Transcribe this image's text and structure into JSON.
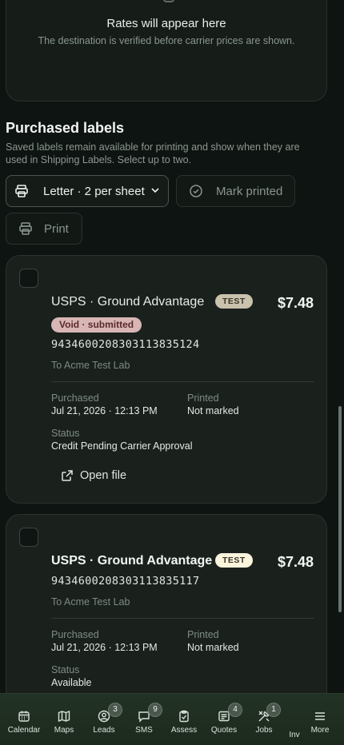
{
  "rates": {
    "title": "Rates will appear here",
    "subtitle": "The destination is verified before carrier prices are shown."
  },
  "purchased": {
    "title": "Purchased labels",
    "description": "Saved labels remain available for printing and show when they are used in Shipping Labels. Select up to two.",
    "format_select": "Letter · 2 per sheet",
    "mark_printed": "Mark printed",
    "print": "Print"
  },
  "labels": [
    {
      "carrier": "USPS · Ground Advantage",
      "tag": "TEST",
      "price": "$7.48",
      "badge": "Void · submitted",
      "tracking": "9434600208303113835124",
      "to": "To Acme Test Lab",
      "purchased_label": "Purchased",
      "purchased_value": "Jul 21, 2026 · 12:13 PM",
      "printed_label": "Printed",
      "printed_value": "Not marked",
      "status_label": "Status",
      "status_value": "Credit Pending Carrier Approval",
      "open_file": "Open file"
    },
    {
      "carrier": "USPS · Ground Advantage",
      "tag": "TEST",
      "price": "$7.48",
      "tracking": "9434600208303113835117",
      "to": "To Acme Test Lab",
      "purchased_label": "Purchased",
      "purchased_value": "Jul 21, 2026 · 12:13 PM",
      "printed_label": "Printed",
      "printed_value": "Not marked",
      "status_label": "Status",
      "status_value": "Available"
    }
  ],
  "nav": [
    {
      "label": "Calendar",
      "icon": "calendar-icon"
    },
    {
      "label": "Maps",
      "icon": "map-icon"
    },
    {
      "label": "Leads",
      "icon": "person-icon",
      "badge": "3"
    },
    {
      "label": "SMS",
      "icon": "chat-icon",
      "badge": "9"
    },
    {
      "label": "Assess",
      "icon": "clipboard-icon"
    },
    {
      "label": "Quotes",
      "icon": "invoice-icon",
      "badge": "4"
    },
    {
      "label": "Jobs",
      "icon": "tools-icon",
      "badge": "1"
    },
    {
      "label": "Inv",
      "icon": "box-icon"
    },
    {
      "label": "More",
      "icon": "menu-icon"
    }
  ]
}
